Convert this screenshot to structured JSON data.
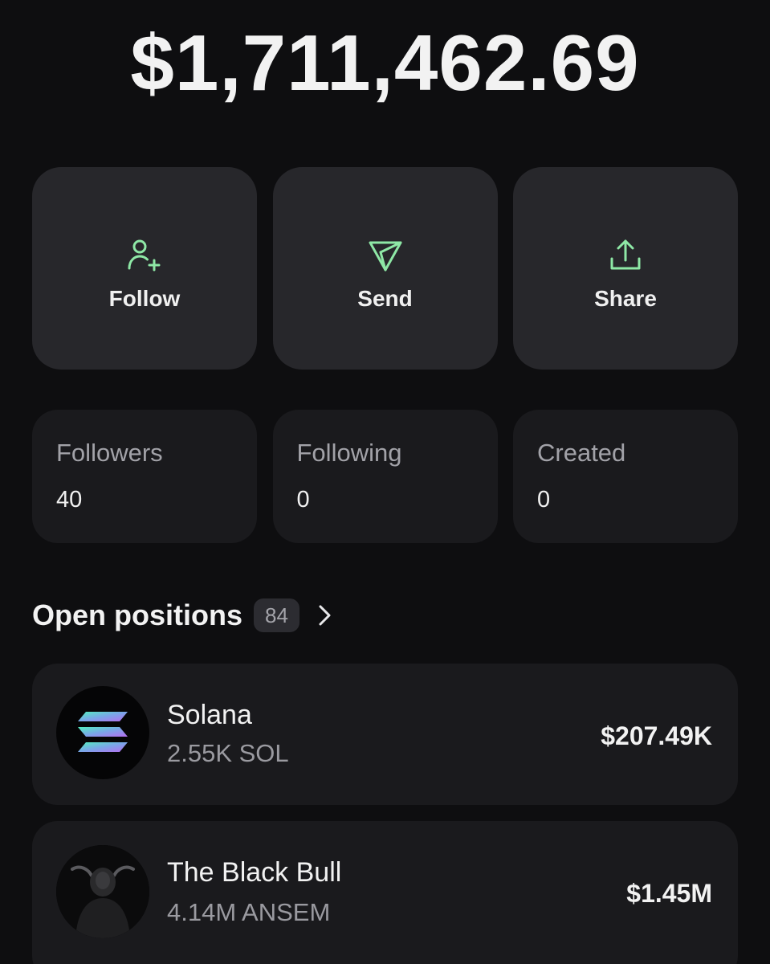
{
  "balance": "$1,711,462.69",
  "actions": [
    {
      "label": "Follow",
      "icon": "person-add-icon"
    },
    {
      "label": "Send",
      "icon": "send-icon"
    },
    {
      "label": "Share",
      "icon": "share-icon"
    }
  ],
  "stats": [
    {
      "label": "Followers",
      "value": "40"
    },
    {
      "label": "Following",
      "value": "0"
    },
    {
      "label": "Created",
      "value": "0"
    }
  ],
  "open_positions": {
    "title": "Open positions",
    "count": "84",
    "items": [
      {
        "name": "Solana",
        "amount": "2.55K SOL",
        "value": "$207.49K",
        "icon": "solana-logo"
      },
      {
        "name": "The Black Bull",
        "amount": "4.14M ANSEM",
        "value": "$1.45M",
        "icon": "black-bull-avatar"
      }
    ]
  },
  "colors": {
    "background": "#0e0e10",
    "card": "#1a1a1d",
    "action_card": "#27272b",
    "accent_green": "#8ee8a6",
    "muted_text": "#a2a2a8"
  }
}
